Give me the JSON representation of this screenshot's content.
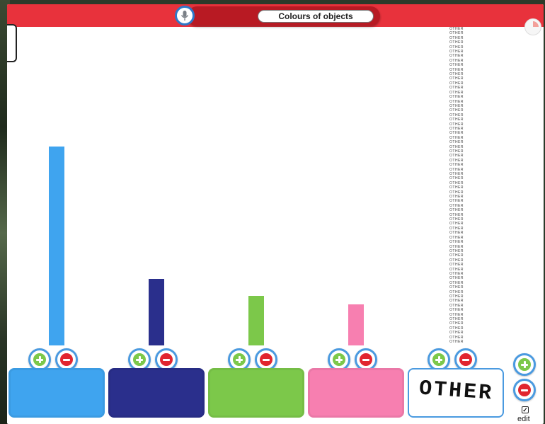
{
  "header": {
    "title": "Colours of objects"
  },
  "tower": {
    "word": "OTHER",
    "count": 70
  },
  "edit": {
    "label": "edit",
    "check_glyph": "✓",
    "checked": true
  },
  "chart_data": {
    "type": "bar",
    "categories": [
      "blue",
      "dark blue",
      "green",
      "pink",
      "OTHER"
    ],
    "values": [
      12,
      4,
      3,
      2.5,
      19
    ],
    "colors": [
      "#3fa4ef",
      "#2a2f8c",
      "#7cc84a",
      "#f77fb0",
      "#ffffff"
    ],
    "ylim": [
      0,
      20
    ],
    "title": "Colours of objects",
    "xlabel": "",
    "ylabel": ""
  },
  "columns": [
    {
      "name": "blue",
      "bar_color": "#3fa4ef",
      "tile_color": "#3fa4ef",
      "tile_text": ""
    },
    {
      "name": "dark-blue",
      "bar_color": "#2a2f8c",
      "tile_color": "#2a2f8c",
      "tile_text": ""
    },
    {
      "name": "green",
      "bar_color": "#7cc84a",
      "tile_color": "#7cc84a",
      "tile_text": ""
    },
    {
      "name": "pink",
      "bar_color": "#f77fb0",
      "tile_color": "#f77fb0",
      "tile_text": ""
    },
    {
      "name": "other",
      "bar_color": "#ffffff",
      "tile_color": "#ffffff",
      "tile_text": "OTHER"
    }
  ],
  "icons": {
    "mic": "microphone-icon",
    "plus": "plus-icon",
    "minus": "minus-icon",
    "corner": "pie-icon"
  },
  "colors": {
    "topbar": "#e8323c",
    "title_strip": "#b81a23",
    "control_ring": "#4a9ae0",
    "plus": "#7cc84a",
    "minus": "#e1252f"
  }
}
